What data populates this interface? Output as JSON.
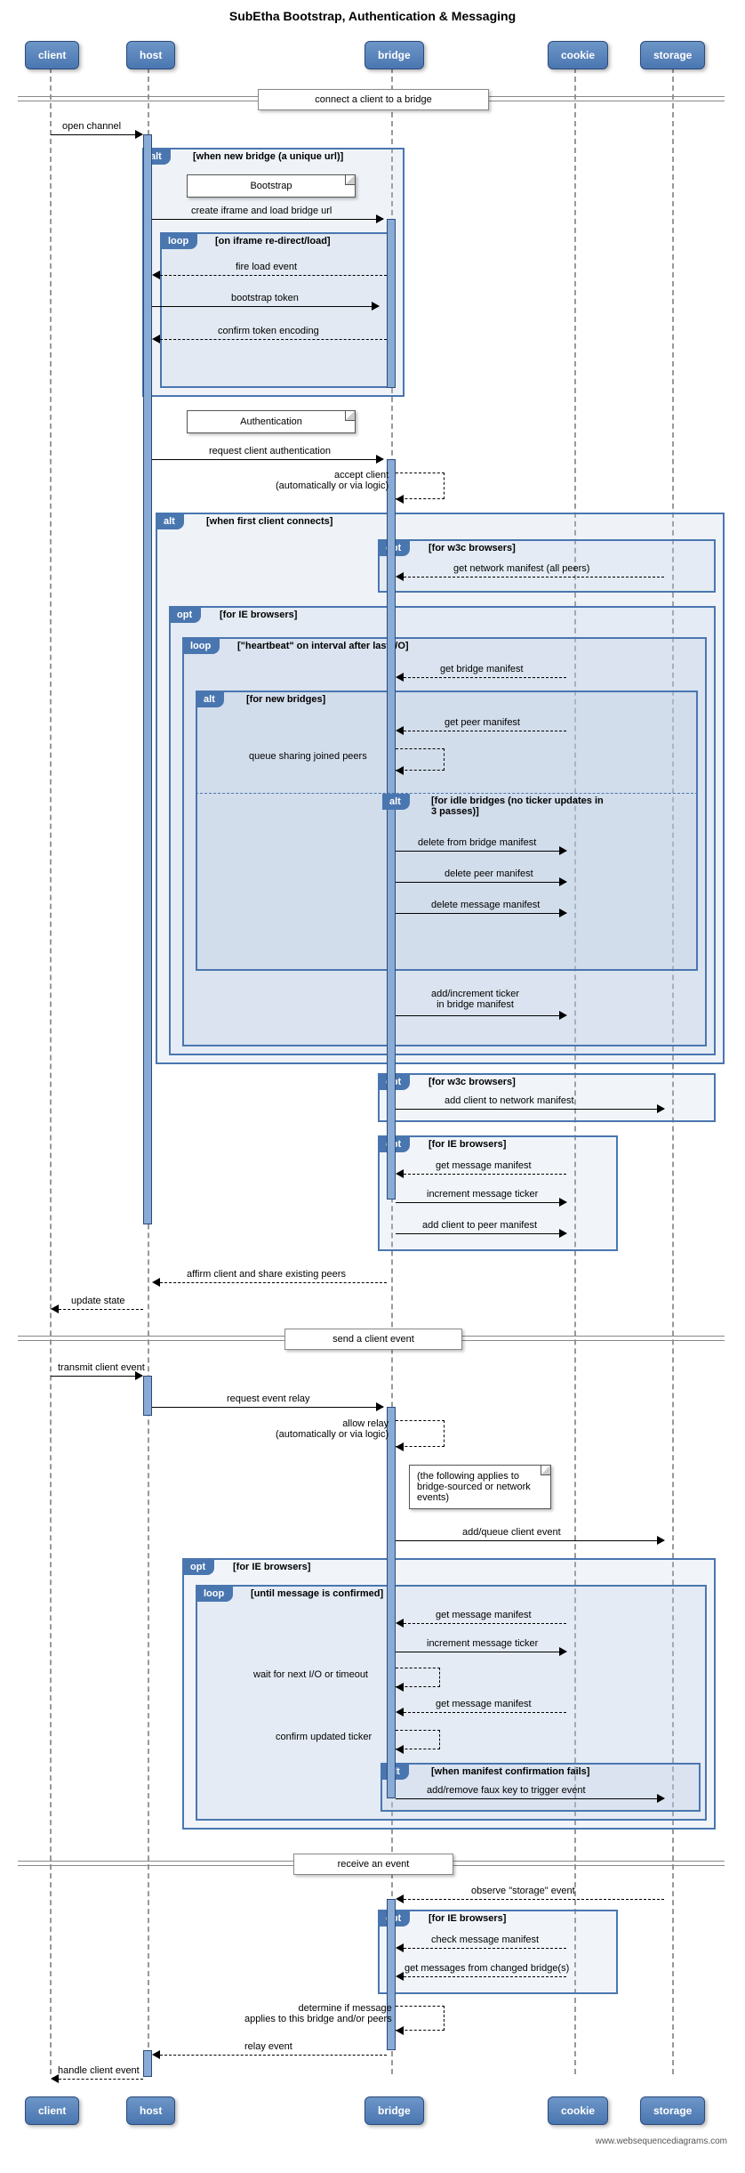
{
  "title": "SubEtha Bootstrap, Authentication & Messaging",
  "participants": {
    "client": "client",
    "host": "host",
    "bridge": "bridge",
    "cookie": "cookie",
    "storage": "storage"
  },
  "dividers": {
    "d1": "connect a client to a bridge",
    "d2": "send a client event",
    "d3": "receive an event"
  },
  "messages": {
    "open_channel": "open channel",
    "create_iframe": "create iframe and load bridge url",
    "fire_load": "fire load event",
    "bootstrap_token": "bootstrap token",
    "confirm_token": "confirm token encoding",
    "request_auth": "request client authentication",
    "accept_client": "accept client\n(automatically or via logic)",
    "get_network_manifest": "get network manifest (all peers)",
    "get_bridge_manifest": "get bridge manifest",
    "get_peer_manifest": "get peer manifest",
    "queue_sharing": "queue sharing joined peers",
    "delete_bridge": "delete from bridge manifest",
    "delete_peer": "delete peer manifest",
    "delete_message": "delete message manifest",
    "add_ticker": "add/increment ticker\nin bridge manifest",
    "add_client_network": "add client to network manifest",
    "get_msg_manifest": "get message manifest",
    "inc_msg_ticker": "increment message ticker",
    "add_client_peer": "add client to peer manifest",
    "affirm_client": "affirm client and share existing peers",
    "update_state": "update state",
    "transmit_event": "transmit client event",
    "request_relay": "request event relay",
    "allow_relay": "allow relay\n(automatically or via logic)",
    "add_queue_event": "add/queue client event",
    "get_msg_manifest2": "get message manifest",
    "inc_msg_ticker2": "increment message ticker",
    "wait_io": "wait for next I/O or timeout",
    "get_msg_manifest3": "get message manifest",
    "confirm_ticker": "confirm updated ticker",
    "add_remove_faux": "add/remove faux key to trigger event",
    "observe_storage": "observe \"storage\" event",
    "check_msg_manifest": "check message manifest",
    "get_msgs_changed": "get messages from changed bridge(s)",
    "determine_msg": "determine if message\napplies to this bridge and/or peers",
    "relay_event": "relay event",
    "handle_client_event": "handle client event"
  },
  "notes": {
    "bootstrap": "Bootstrap",
    "authentication": "Authentication",
    "bridge_sourced": "(the following applies to\nbridge-sourced or network\nevents)"
  },
  "groups": {
    "alt_new_bridge": "[when new bridge (a unique url)]",
    "loop_iframe": "[on iframe re-direct/load]",
    "alt_first_client": "[when first client connects]",
    "opt_w3c_1": "[for w3c browsers]",
    "opt_ie_1": "[for IE browsers]",
    "loop_heartbeat": "[\"heartbeat\" on interval after last I/O]",
    "alt_new_bridges": "[for new bridges]",
    "alt_idle_bridges": "[for idle bridges (no ticker updates in\n3 passes)]",
    "opt_w3c_2": "[for w3c browsers]",
    "opt_ie_2": "[for IE browsers]",
    "opt_ie_3": "[for IE browsers]",
    "loop_confirmed": "[until message is confirmed]",
    "alt_manifest_fail": "[when manifest confirmation fails]",
    "opt_ie_4": "[for IE browsers]"
  },
  "tags": {
    "alt": "alt",
    "loop": "loop",
    "opt": "opt"
  },
  "footer": "www.websequencediagrams.com"
}
